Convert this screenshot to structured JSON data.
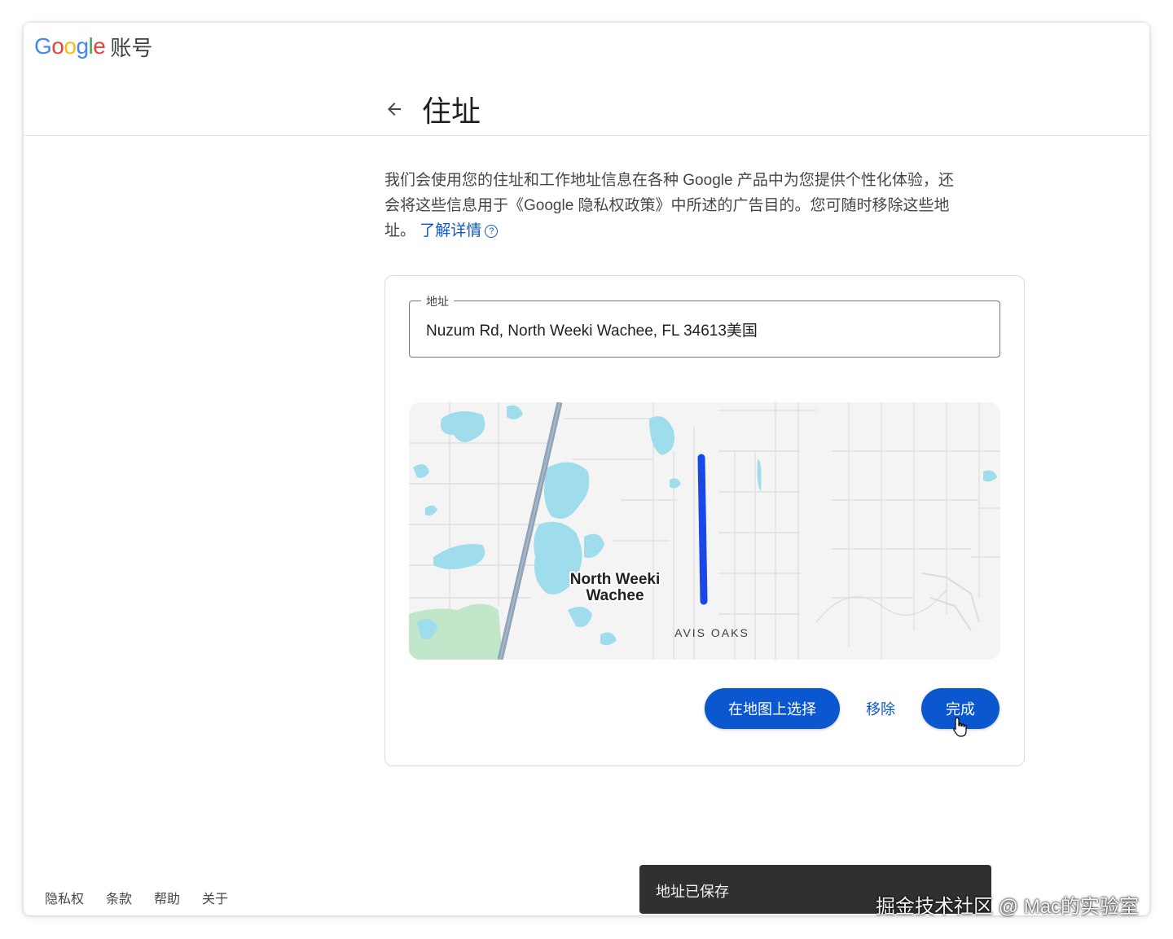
{
  "header": {
    "logo_text": "Google",
    "product_name": "账号",
    "page_title": "住址"
  },
  "description": {
    "text": "我们会使用您的住址和工作地址信息在各种 Google 产品中为您提供个性化体验，还会将这些信息用于《Google 隐私权政策》中所述的广告目的。您可随时移除这些地址。",
    "learn_more": "了解详情",
    "help_icon": "?"
  },
  "address_field": {
    "label": "地址",
    "value": "Nuzum Rd, North Weeki Wachee, FL 34613美国"
  },
  "map": {
    "place_label_line1": "North Weeki",
    "place_label_line2": "Wachee",
    "area_label": "AVIS OAKS",
    "route_color": "#1a47e8",
    "water_color": "#9fdcec",
    "park_color": "#c2e6c9",
    "highway_color": "#8ea3b8"
  },
  "actions": {
    "choose_on_map": "在地图上选择",
    "remove": "移除",
    "done": "完成"
  },
  "footer": {
    "links": [
      "隐私权",
      "条款",
      "帮助",
      "关于"
    ]
  },
  "toast": {
    "message": "地址已保存"
  },
  "watermark": "掘金技术社区 @ Mac的实验室",
  "colors": {
    "accent": "#0b57d0",
    "google_blue": "#4285f4",
    "google_red": "#ea4335",
    "google_yellow": "#fbbc05",
    "google_green": "#34a853"
  }
}
